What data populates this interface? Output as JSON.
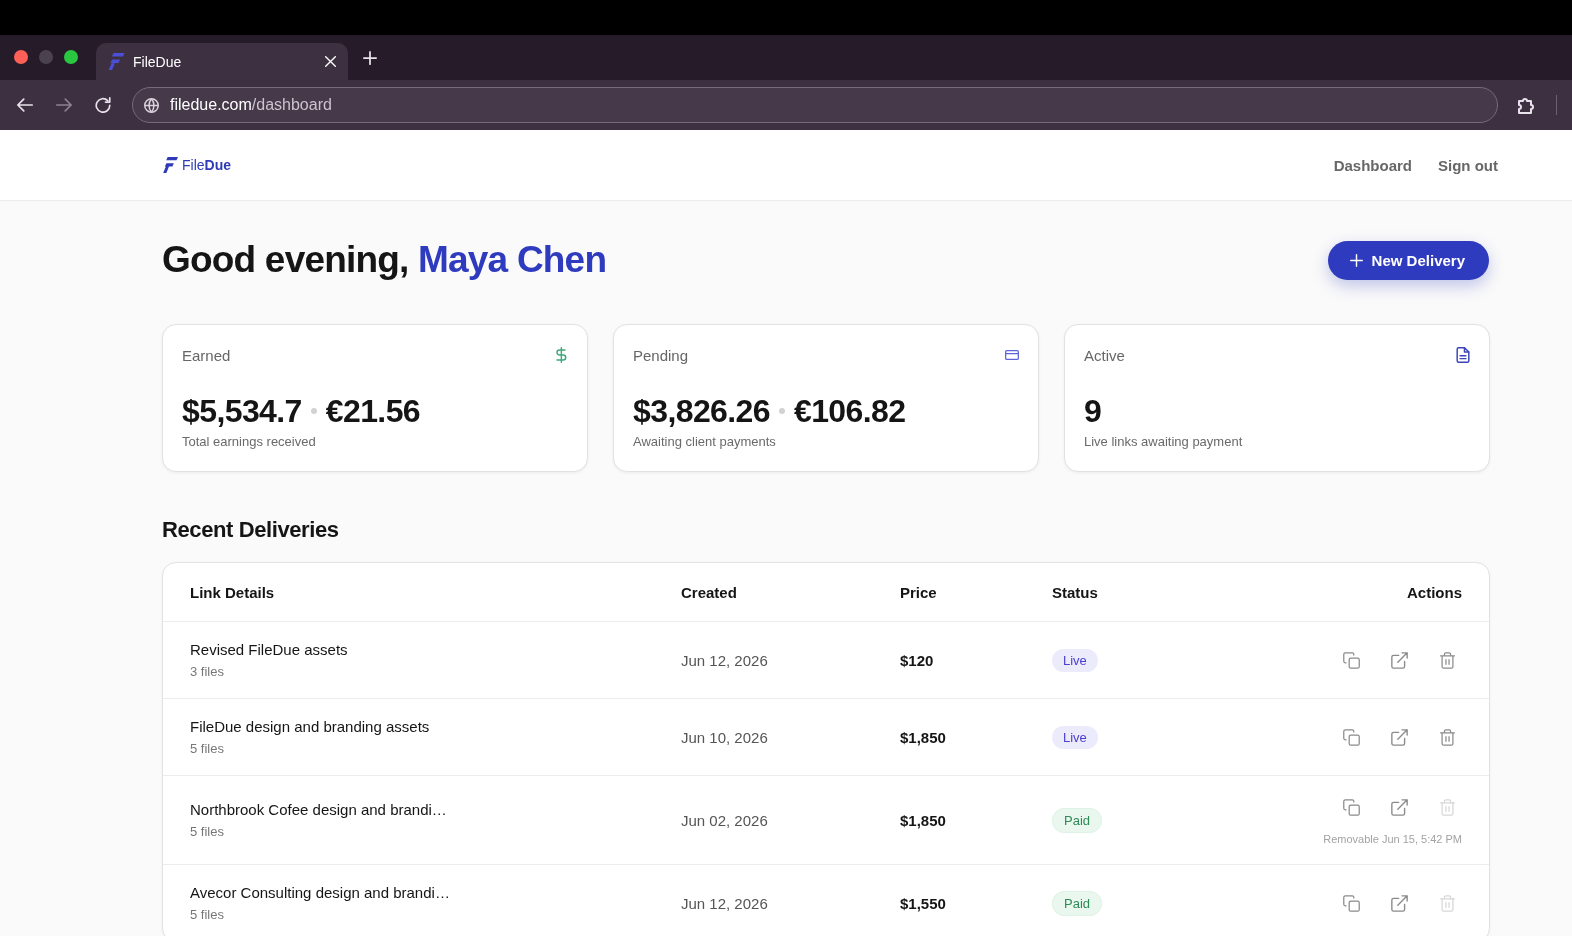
{
  "browser": {
    "tab": {
      "title": "FileDue"
    },
    "nav_buttons": [
      {
        "kind": "back",
        "disabled": false
      },
      {
        "kind": "forward",
        "disabled": true
      },
      {
        "kind": "reload",
        "disabled": false
      }
    ],
    "address": {
      "host": "filedue.com",
      "path": "/dashboard"
    }
  },
  "header": {
    "logo": "File**Due**",
    "nav": [
      {
        "label": "Dashboard"
      },
      {
        "label": "Sign out"
      }
    ]
  },
  "greeting": {
    "text": "Good evening,",
    "name": "Maya Chen"
  },
  "new_delivery_button": {
    "label": "New Delivery"
  },
  "stats": [
    {
      "kind": "earned",
      "label": "Earned",
      "amounts": [
        "$5,534.7",
        "€21.56"
      ],
      "caption": "Total earnings received"
    },
    {
      "kind": "pending",
      "label": "Pending",
      "amounts": [
        "$3,826.26",
        "€106.82"
      ],
      "caption": "Awaiting client payments"
    },
    {
      "kind": "active",
      "label": "Active",
      "amounts": [
        "9"
      ],
      "caption": "Live links awaiting payment"
    }
  ],
  "recent_deliveries": {
    "title": "Recent Deliveries",
    "columns": [
      "Link Details",
      "Created",
      "Price",
      "Status",
      "Actions"
    ],
    "rows": [
      {
        "title": "Revised FileDue assets",
        "files": "3 files",
        "created": "Jun 12, 2026",
        "price": "$120",
        "status": {
          "kind": "live",
          "label": "Live"
        },
        "delete_disabled": false
      },
      {
        "title": "FileDue design and branding assets",
        "files": "5 files",
        "created": "Jun 10, 2026",
        "price": "$1,850",
        "status": {
          "kind": "live",
          "label": "Live"
        },
        "delete_disabled": false
      },
      {
        "title": "Northbrook Cofee design and brandi…",
        "files": "5 files",
        "created": "Jun 02, 2026",
        "price": "$1,850",
        "status": {
          "kind": "paid",
          "label": "Paid"
        },
        "delete_disabled": true,
        "note": "Removable Jun 15, 5:42 PM"
      },
      {
        "title": "Avecor Consulting design and brandi…",
        "files": "5 files",
        "created": "Jun 12, 2026",
        "price": "$1,550",
        "status": {
          "kind": "paid",
          "label": "Paid"
        },
        "delete_disabled": true
      }
    ]
  }
}
